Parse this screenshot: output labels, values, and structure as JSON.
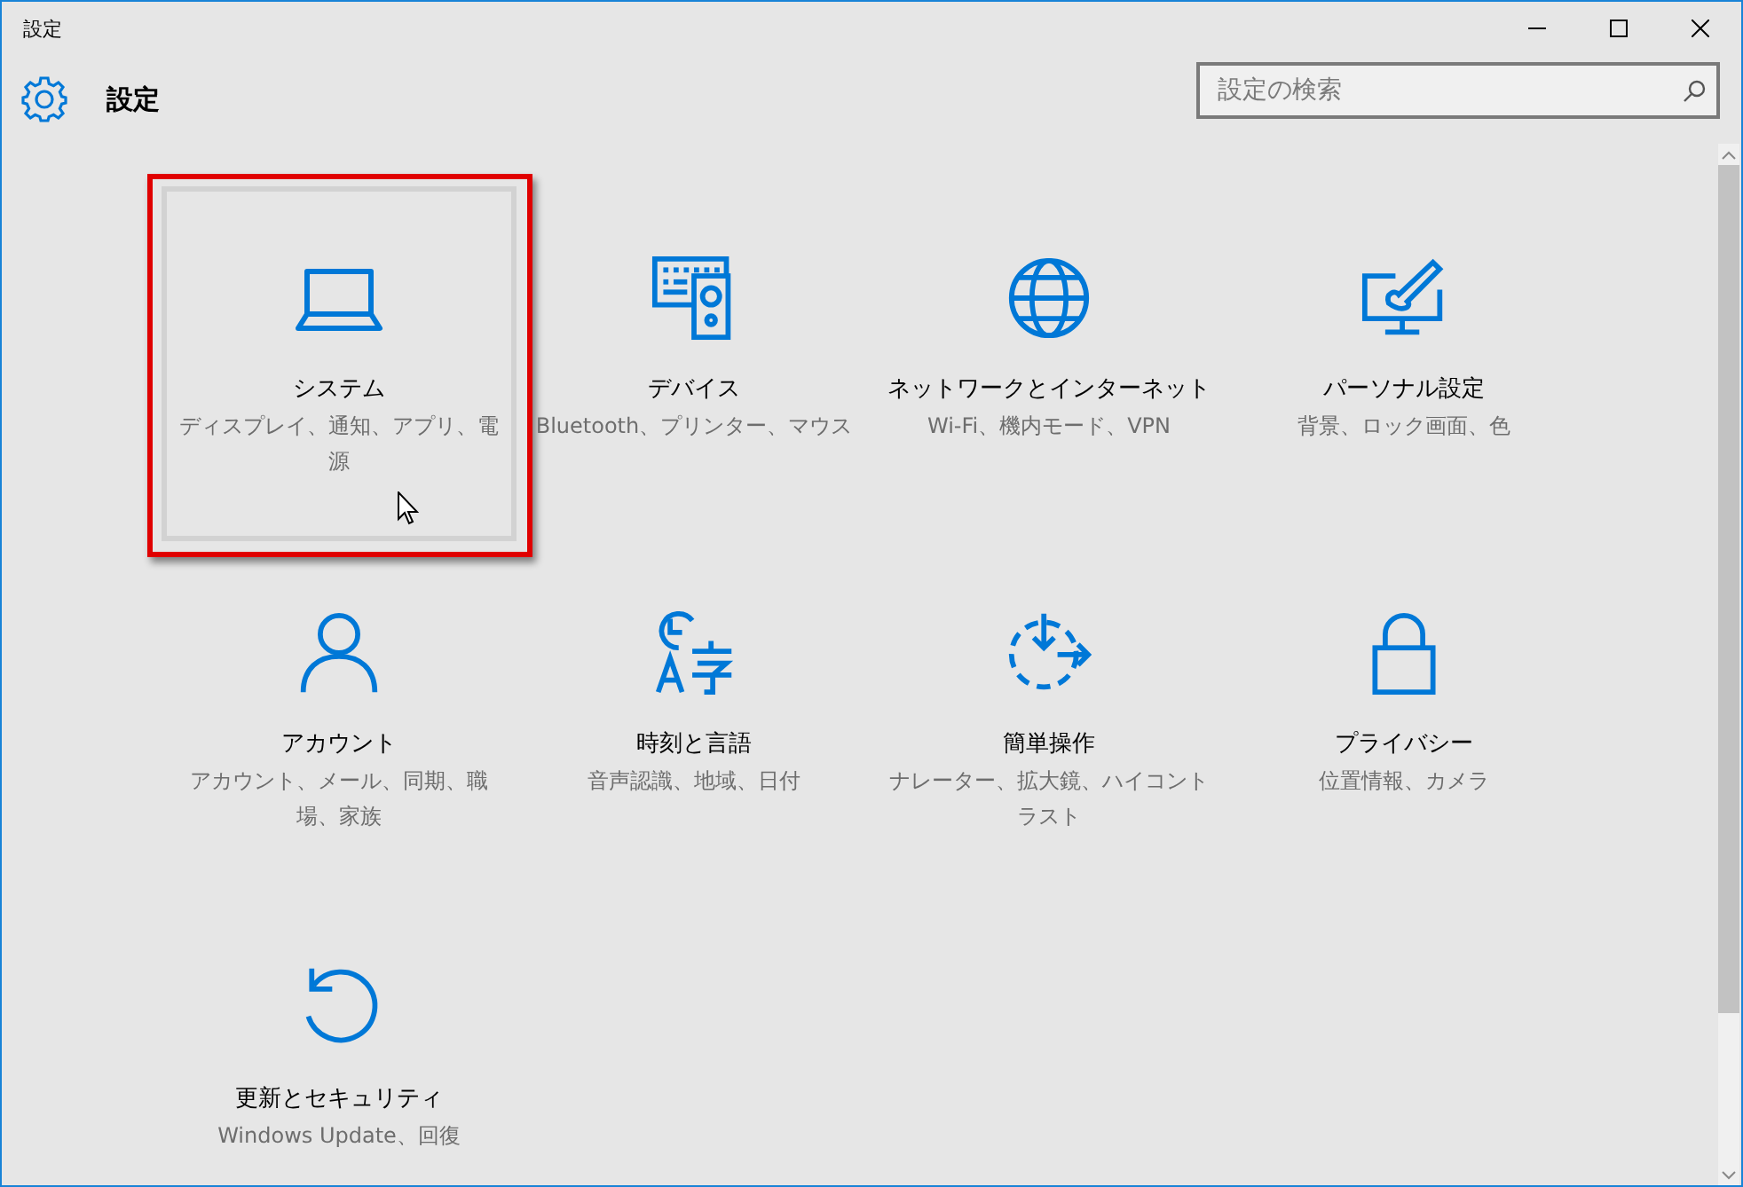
{
  "window": {
    "title": "設定"
  },
  "header": {
    "title": "設定"
  },
  "search": {
    "placeholder": "設定の検索"
  },
  "tiles": [
    {
      "kind": "system",
      "title": "システム",
      "subtitle": "ディスプレイ、通知、アプリ、電源",
      "selected": true,
      "annotated": true
    },
    {
      "kind": "devices",
      "title": "デバイス",
      "subtitle": "Bluetooth、プリンター、マウス",
      "selected": false,
      "annotated": false
    },
    {
      "kind": "network",
      "title": "ネットワークとインターネット",
      "subtitle": "Wi-Fi、機内モード、VPN",
      "selected": false,
      "annotated": false
    },
    {
      "kind": "personalization",
      "title": "パーソナル設定",
      "subtitle": "背景、ロック画面、色",
      "selected": false,
      "annotated": false
    },
    {
      "kind": "accounts",
      "title": "アカウント",
      "subtitle": "アカウント、メール、同期、職場、家族",
      "selected": false,
      "annotated": false
    },
    {
      "kind": "time",
      "title": "時刻と言語",
      "subtitle": "音声認識、地域、日付",
      "selected": false,
      "annotated": false
    },
    {
      "kind": "ease",
      "title": "簡単操作",
      "subtitle": "ナレーター、拡大鏡、ハイコントラスト",
      "selected": false,
      "annotated": false
    },
    {
      "kind": "privacy",
      "title": "プライバシー",
      "subtitle": "位置情報、カメラ",
      "selected": false,
      "annotated": false
    },
    {
      "kind": "update",
      "title": "更新とセキュリティ",
      "subtitle": "Windows Update、回復",
      "selected": false,
      "annotated": false
    }
  ]
}
